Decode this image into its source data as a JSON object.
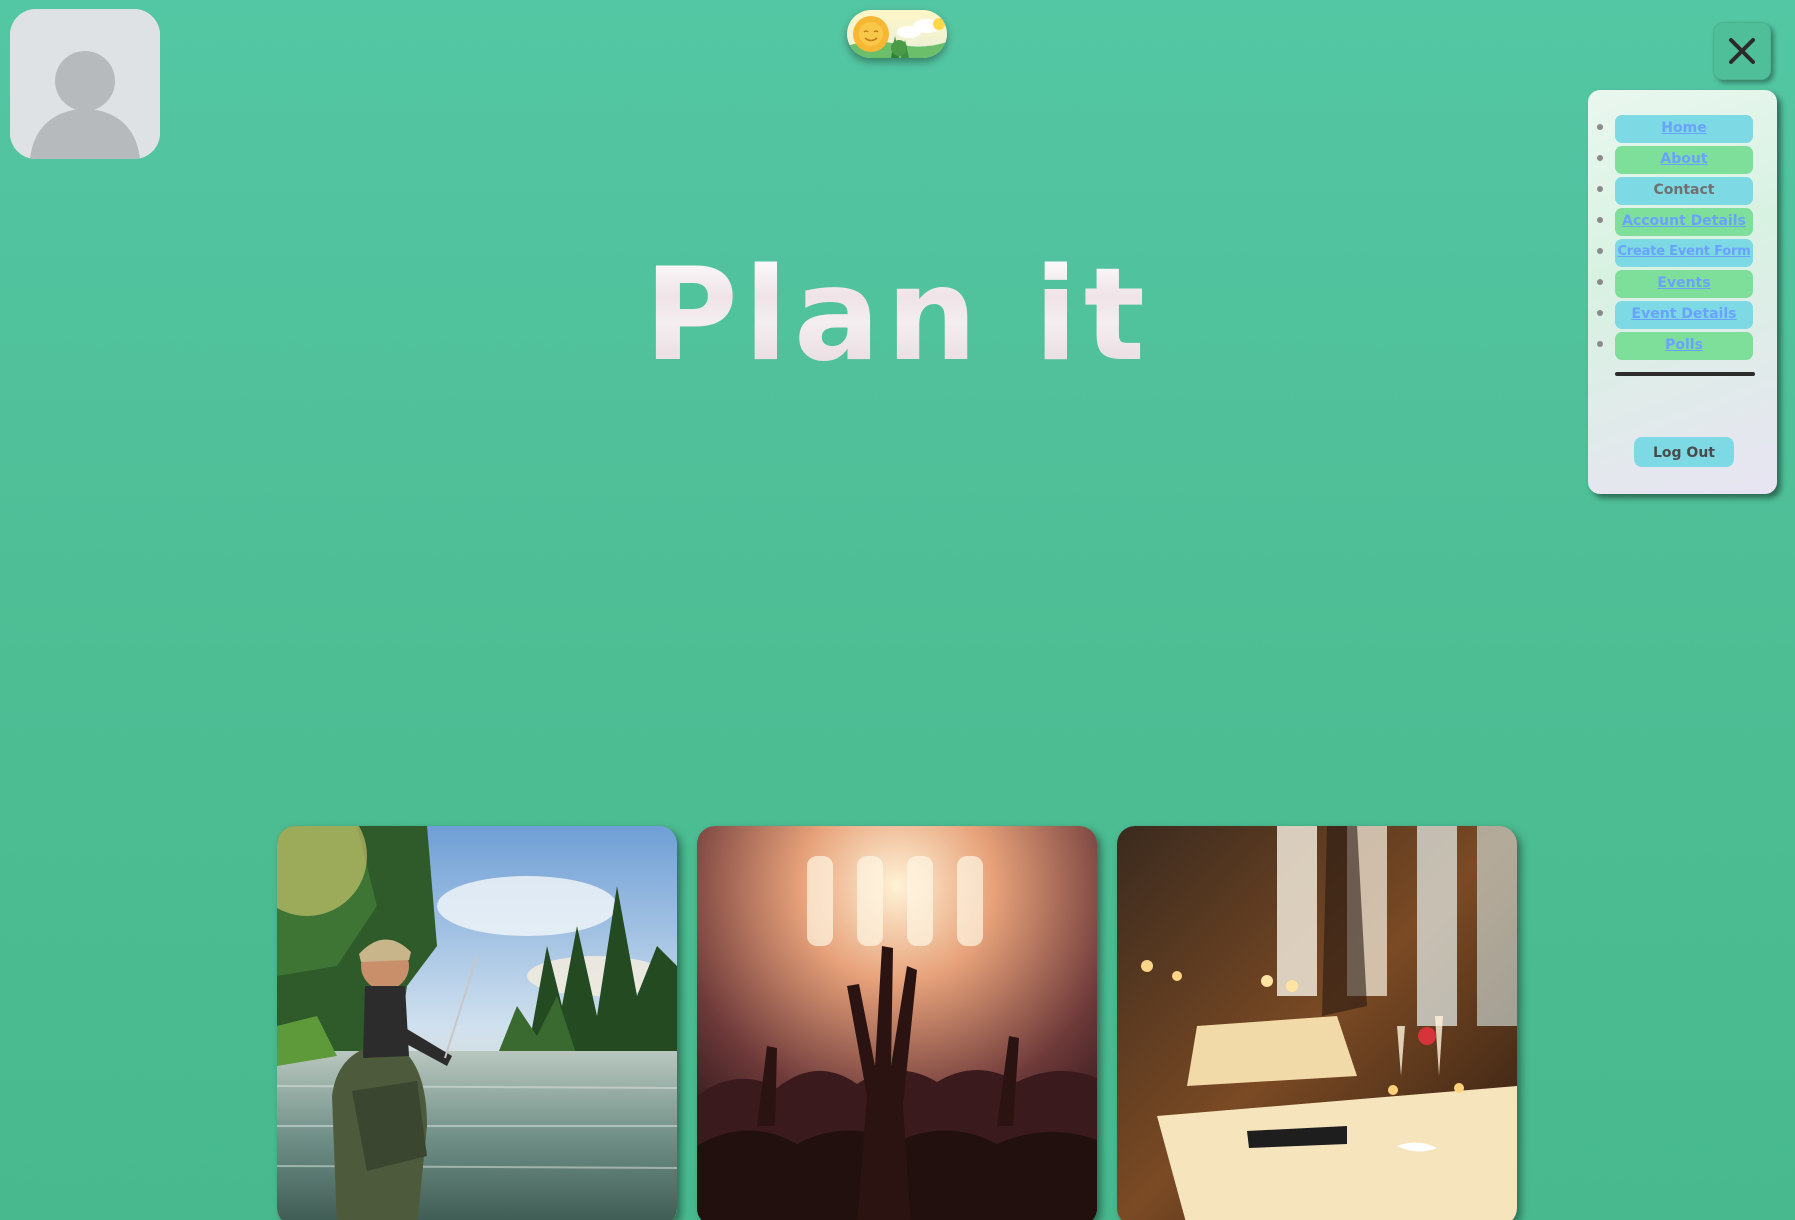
{
  "header": {
    "title": "Plan it"
  },
  "icons": {
    "avatar": "user-avatar-icon",
    "theme_toggle": "sun-landscape-icon",
    "close": "close-icon"
  },
  "nav": {
    "items": [
      {
        "label": "Home"
      },
      {
        "label": "About"
      },
      {
        "label": "Contact"
      },
      {
        "label": "Account Details"
      },
      {
        "label": "Create Event Form"
      },
      {
        "label": "Events"
      },
      {
        "label": "Event Details"
      },
      {
        "label": "Polls"
      }
    ],
    "logout_label": "Log Out"
  },
  "cards": [
    {
      "image": "fishing-river-photo"
    },
    {
      "image": "concert-crowd-photo"
    },
    {
      "image": "restaurant-dining-photo"
    }
  ],
  "colors": {
    "background": "#4fbf99",
    "nav_blue": "#7dd9e3",
    "nav_green": "#7ddf99",
    "link": "#6aa3ff"
  }
}
